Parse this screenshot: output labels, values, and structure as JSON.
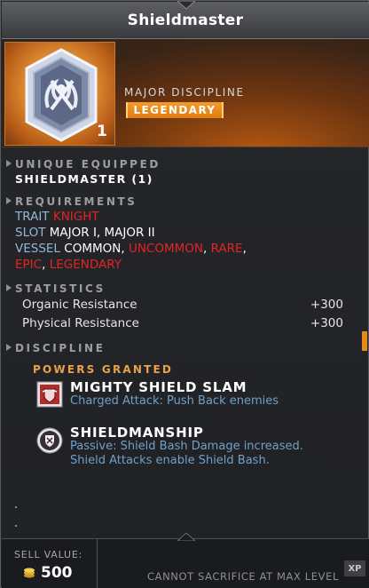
{
  "header": {
    "title": "Shieldmaster"
  },
  "item": {
    "icon": "shieldmaster-crest-icon",
    "count": "1",
    "category": "MAJOR DISCIPLINE",
    "rarity": "LEGENDARY",
    "rarity_color": "#f08a1a"
  },
  "unique_equipped": {
    "label": "UNIQUE EQUIPPED",
    "value": "SHIELDMASTER (1)"
  },
  "requirements": {
    "label": "REQUIREMENTS",
    "trait_key": "TRAIT",
    "trait_value": "KNIGHT",
    "slot_key": "SLOT",
    "slot_value": "MAJOR I, MAJOR II",
    "vessel_key": "VESSEL",
    "vessel_common": "COMMON",
    "vessel_uncommon": "UNCOMMON",
    "vessel_rare": "RARE",
    "vessel_epic": "EPIC",
    "vessel_legendary": "LEGENDARY",
    "unmet_color": "#e22424"
  },
  "statistics": {
    "label": "STATISTICS",
    "rows": [
      {
        "name": "Organic Resistance",
        "value": "+300"
      },
      {
        "name": "Physical Resistance",
        "value": "+300"
      }
    ]
  },
  "discipline": {
    "label": "DISCIPLINE",
    "powers_label": "POWERS GRANTED",
    "powers": [
      {
        "icon": "shield-slam-icon",
        "name": "MIGHTY SHIELD SLAM",
        "desc": "Charged Attack: Push Back enemies"
      },
      {
        "icon": "shield-bash-icon",
        "name": "SHIELDMANSHIP",
        "desc": "Passive: Shield Bash Damage increased. Shield Attacks enable Shield Bash."
      }
    ]
  },
  "footer": {
    "sell_label": "SELL VALUE:",
    "sell_value": "500",
    "coin_icon": "gold-coins-icon",
    "sacrifice_text": "CANNOT SACRIFICE AT MAX LEVEL",
    "xp_label": "XP"
  },
  "colors": {
    "accent_orange": "#e9a24a",
    "key_blue": "#8fb8d8",
    "desc_blue": "#6fa0c8"
  }
}
